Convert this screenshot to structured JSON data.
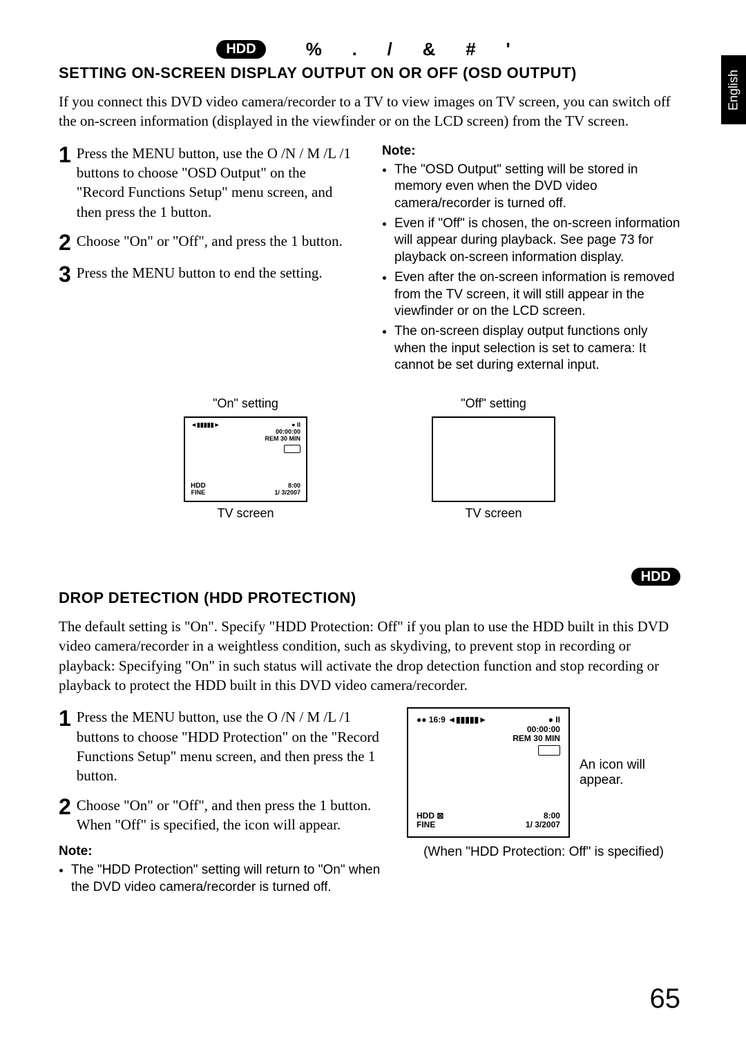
{
  "lang": "English",
  "media_badge": "HDD",
  "media_symbols": [
    "%",
    ".",
    "/",
    "&",
    "#",
    "'"
  ],
  "section1": {
    "heading": "SETTING ON-SCREEN DISPLAY OUTPUT ON OR OFF (OSD OUTPUT)",
    "intro": "If you connect this DVD video camera/recorder to a TV to view images on TV screen, you can switch off the on-screen information (displayed in the viewfinder or on the LCD screen) from the TV screen.",
    "steps": [
      "Press the MENU button, use the O /N / M /L /1 buttons to choose \"OSD Output\" on the \"Record Functions Setup\" menu screen, and then press the 1 button.",
      "Choose \"On\" or \"Off\", and press the 1 button.",
      "Press the MENU button to end the setting."
    ],
    "note_head": "Note:",
    "notes": [
      "The \"OSD Output\" setting will be stored in memory even when the DVD video camera/recorder is turned off.",
      "Even if \"Off\" is chosen, the on-screen information will appear during playback. See page 73 for playback on-screen information display.",
      "Even after the on-screen information is removed from the TV screen, it will still appear in the viewfinder or on the LCD screen.",
      "The on-screen display output functions only when the input selection is set to camera: It cannot be set during external input."
    ],
    "on_label": "\"On\" setting",
    "off_label": "\"Off\" setting",
    "tv_caption": "TV screen",
    "tv_overlay": {
      "rec_pause": "● II",
      "time": "00:00:00",
      "rem": "REM 30 MIN",
      "hdd": "HDD",
      "fine": "FINE",
      "clock": "8:00",
      "date": "1/ 3/2007",
      "battery": "◄▮▮▮▮▮►"
    }
  },
  "section2": {
    "badge": "HDD",
    "heading": "DROP DETECTION (HDD PROTECTION)",
    "intro": "The default setting is \"On\". Specify \"HDD Protection: Off\" if you plan to use the HDD built in this DVD video camera/recorder in a weightless condition, such as skydiving, to prevent stop in recording or playback: Specifying \"On\" in such status will activate the drop detection function and stop recording or playback to protect the HDD built in this DVD video camera/recorder.",
    "steps": [
      "Press the MENU button, use the O /N / M /L /1 buttons to choose \"HDD Protection\" on the \"Record Functions Setup\" menu screen, and then press the 1 button.",
      "Choose \"On\" or \"Off\", and then press the 1 button.\nWhen \"Off\" is specified, the icon will appear."
    ],
    "note_head": "Note:",
    "notes": [
      "The \"HDD Protection\" setting will return to \"On\" when the DVD video camera/recorder is turned off."
    ],
    "annot": "An icon will appear.",
    "caption": "(When \"HDD Protection: Off\" is specified)",
    "tv_overlay": {
      "battery": "●● 16:9\n◄▮▮▮▮▮►",
      "rec_pause": "● II",
      "time": "00:00:00",
      "rem": "REM 30 MIN",
      "hdd": "HDD",
      "fine": "FINE",
      "clock": "8:00",
      "date": "1/ 3/2007"
    }
  },
  "page_number": "65"
}
